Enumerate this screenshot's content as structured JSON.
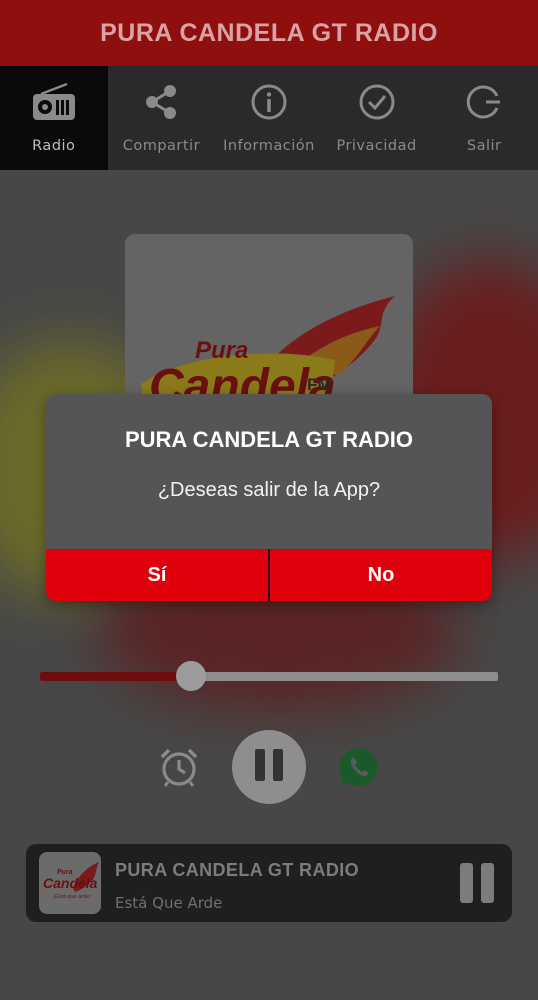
{
  "app": {
    "title": "PURA CANDELA GT RADIO"
  },
  "tabs": [
    {
      "label": "Radio",
      "icon": "radio-icon",
      "active": true
    },
    {
      "label": "Compartir",
      "icon": "share-icon",
      "active": false
    },
    {
      "label": "Información",
      "icon": "info-icon",
      "active": false
    },
    {
      "label": "Privacidad",
      "icon": "check-circle-icon",
      "active": false
    },
    {
      "label": "Salir",
      "icon": "exit-icon",
      "active": false
    }
  ],
  "artwork": {
    "logo_word_1": "Pura",
    "logo_word_2": "Candela",
    "logo_band": "FM"
  },
  "player": {
    "progress": 0.33,
    "controls": [
      "alarm-clock-icon",
      "pause-icon",
      "whatsapp-icon"
    ]
  },
  "mini_player": {
    "title": "PURA CANDELA GT RADIO",
    "subtitle": "Está Que Arde",
    "logo_word_1": "Pura",
    "logo_word_2": "Candela",
    "logo_tagline": "¡Está que arde!"
  },
  "dialog": {
    "title": "PURA CANDELA GT RADIO",
    "message": "¿Deseas salir de la App?",
    "yes_label": "Sí",
    "no_label": "No"
  },
  "colors": {
    "appbar": "#8f0e0e",
    "dialog_button": "#e0000b",
    "slider_fill": "#6e0d0d"
  }
}
